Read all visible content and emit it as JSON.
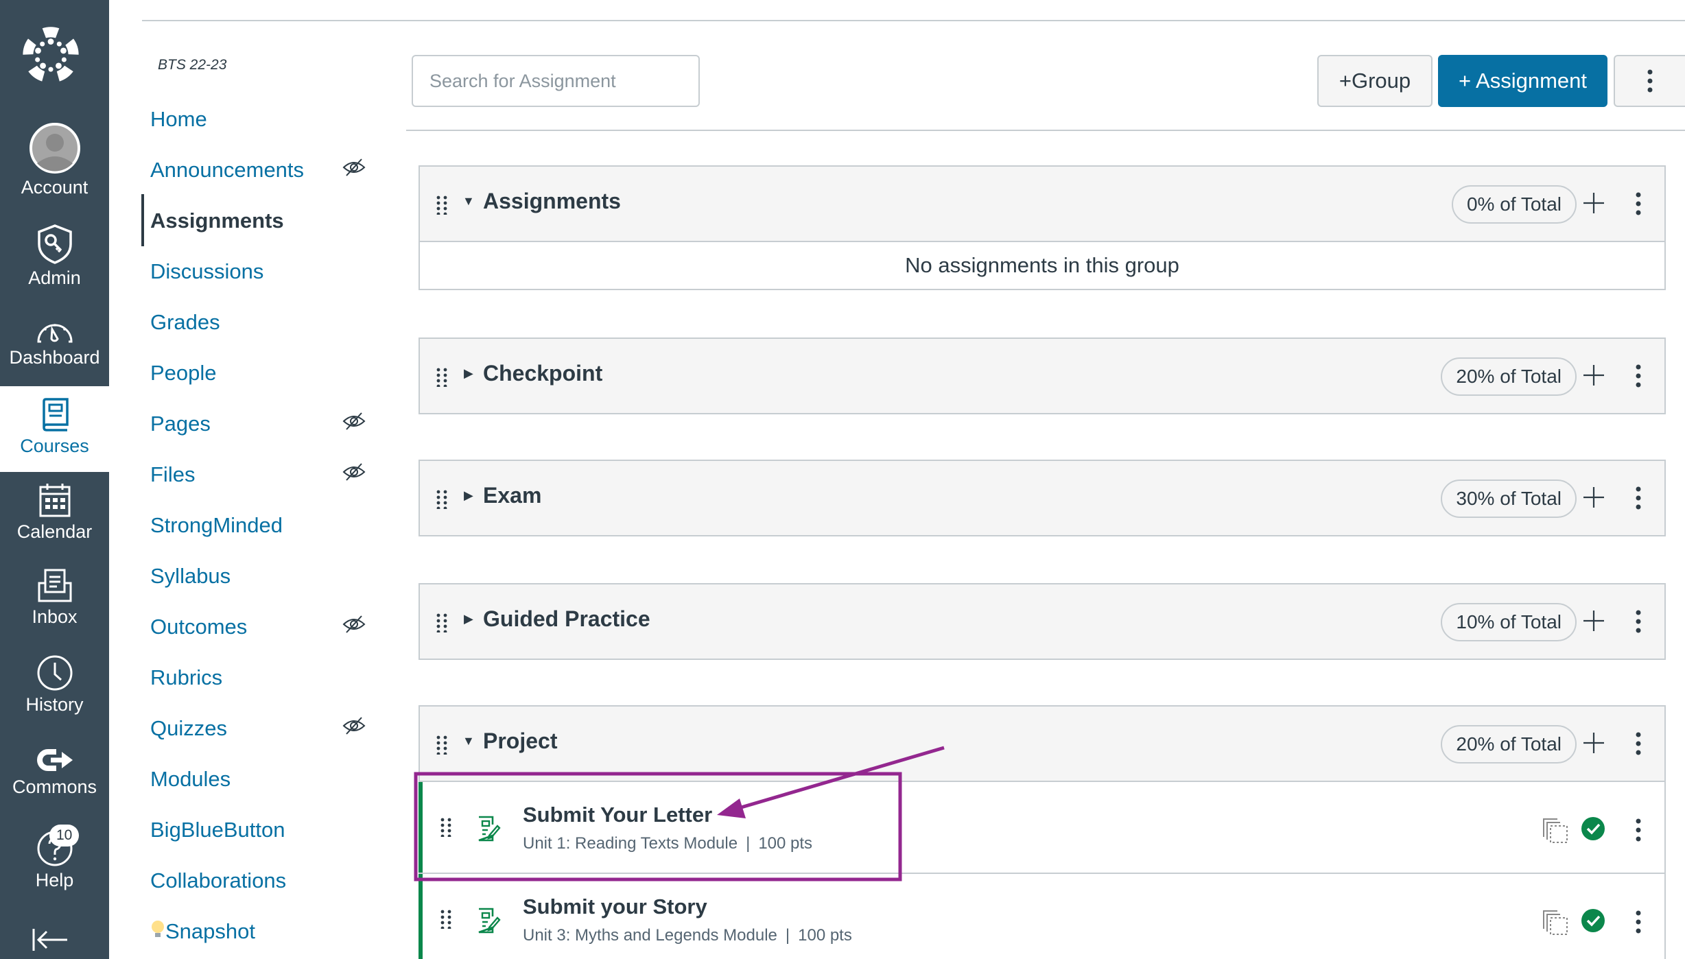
{
  "global_nav": {
    "items": [
      {
        "label": "Account",
        "icon": "user-avatar-icon"
      },
      {
        "label": "Admin",
        "icon": "shield-key-icon"
      },
      {
        "label": "Dashboard",
        "icon": "gauge-icon"
      },
      {
        "label": "Courses",
        "icon": "book-icon",
        "active": true
      },
      {
        "label": "Calendar",
        "icon": "calendar-icon"
      },
      {
        "label": "Inbox",
        "icon": "inbox-icon"
      },
      {
        "label": "History",
        "icon": "clock-icon"
      },
      {
        "label": "Commons",
        "icon": "commons-icon"
      },
      {
        "label": "Help",
        "icon": "help-icon",
        "badge": "10"
      }
    ],
    "collapse_icon": "collapse-left-icon"
  },
  "course_nav": {
    "course_code": "BTS 22-23",
    "items": [
      {
        "label": "Home",
        "hidden": false
      },
      {
        "label": "Announcements",
        "hidden": true
      },
      {
        "label": "Assignments",
        "hidden": false,
        "active": true
      },
      {
        "label": "Discussions",
        "hidden": false
      },
      {
        "label": "Grades",
        "hidden": false
      },
      {
        "label": "People",
        "hidden": false
      },
      {
        "label": "Pages",
        "hidden": true
      },
      {
        "label": "Files",
        "hidden": true
      },
      {
        "label": "StrongMinded",
        "hidden": false
      },
      {
        "label": "Syllabus",
        "hidden": false
      },
      {
        "label": "Outcomes",
        "hidden": true
      },
      {
        "label": "Rubrics",
        "hidden": false
      },
      {
        "label": "Quizzes",
        "hidden": true
      },
      {
        "label": "Modules",
        "hidden": false
      },
      {
        "label": "BigBlueButton",
        "hidden": false
      },
      {
        "label": "Collaborations",
        "hidden": false
      },
      {
        "label": "Snapshot",
        "hidden": false,
        "prefix_icon": "lightbulb-icon"
      }
    ]
  },
  "toolbar": {
    "search_placeholder": "Search for Assignment",
    "search_value": "",
    "add_group_label": "+Group",
    "add_assignment_label": "+ Assignment"
  },
  "groups": [
    {
      "title": "Assignments",
      "expanded": true,
      "weight": "0% of Total",
      "empty_text": "No assignments in this group"
    },
    {
      "title": "Checkpoint",
      "expanded": false,
      "weight": "20% of Total"
    },
    {
      "title": "Exam",
      "expanded": false,
      "weight": "30% of Total"
    },
    {
      "title": "Guided Practice",
      "expanded": false,
      "weight": "10% of Total"
    },
    {
      "title": "Project",
      "expanded": true,
      "weight": "20% of Total",
      "assignments": [
        {
          "title": "Submit Your Letter",
          "module": "Unit 1: Reading Texts Module",
          "points": "100 pts",
          "published": true
        },
        {
          "title": "Submit your Story",
          "module": "Unit 3: Myths and Legends Module",
          "points": "100 pts",
          "published": true
        }
      ]
    }
  ],
  "annotation": {
    "color": "#93278F",
    "target": "Submit Your Letter"
  },
  "colors": {
    "nav_bg": "#394B58",
    "brand": "#0770A3",
    "published": "#0B874B"
  }
}
